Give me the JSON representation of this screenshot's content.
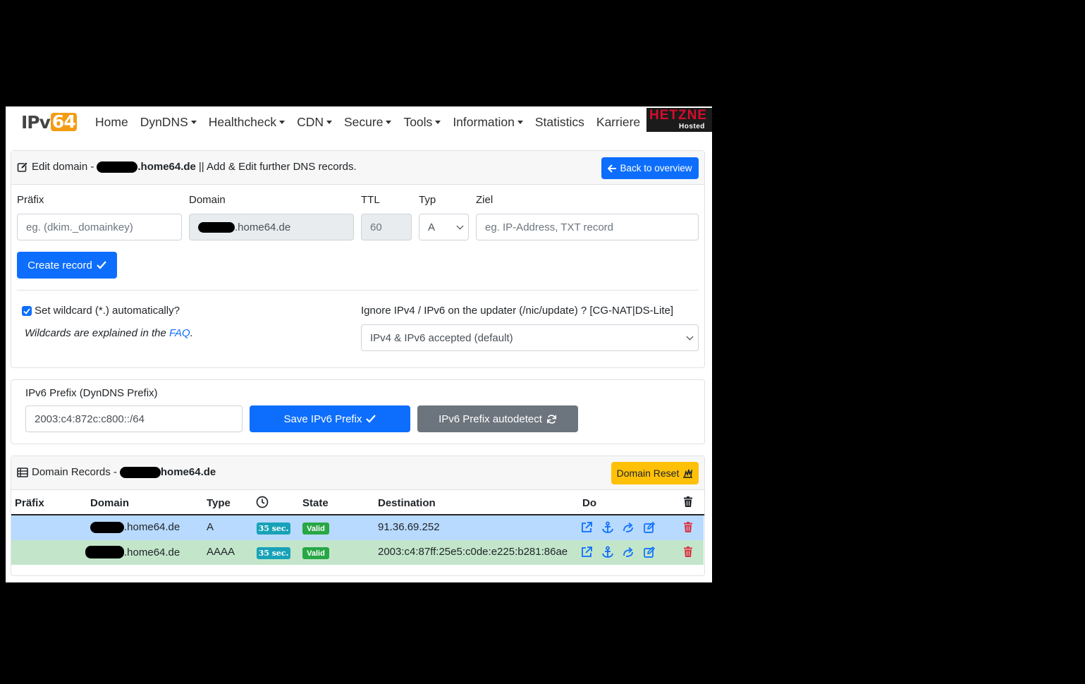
{
  "nav": {
    "logo_text": "IPv",
    "logo_num": "64",
    "items": [
      {
        "label": "Home",
        "dropdown": false
      },
      {
        "label": "DynDNS",
        "dropdown": true
      },
      {
        "label": "Healthcheck",
        "dropdown": true
      },
      {
        "label": "CDN",
        "dropdown": true
      },
      {
        "label": "Secure",
        "dropdown": true
      },
      {
        "label": "Tools",
        "dropdown": true
      },
      {
        "label": "Information",
        "dropdown": true
      },
      {
        "label": "Statistics",
        "dropdown": false
      },
      {
        "label": "Karriere",
        "dropdown": false
      }
    ],
    "sponsor": {
      "name": "HETZNE",
      "sub": "Hosted"
    }
  },
  "edit": {
    "title_prefix": "Edit domain -",
    "domain_suffix": ".home64.de",
    "title_suffix": "|| Add & Edit further DNS records.",
    "back_button": "Back to overview",
    "labels": {
      "prefix": "Präfix",
      "domain": "Domain",
      "ttl": "TTL",
      "type": "Typ",
      "target": "Ziel"
    },
    "prefix_placeholder": "eg. (dkim._domainkey)",
    "domain_value": ".home64.de",
    "ttl_value": "60",
    "type_value": "A",
    "target_placeholder": "eg. IP-Address, TXT record",
    "create_button": "Create record",
    "wildcard_label": "Set wildcard (*.) automatically?",
    "wildcard_checked": true,
    "wildcard_note_prefix": "Wildcards are explained in the",
    "wildcard_link": "FAQ",
    "wildcard_note_suffix": ".",
    "ignore_label": "Ignore IPv4 / IPv6 on the updater (/nic/update) ? [CG-NAT|DS-Lite]",
    "ignore_value": "IPv4 & IPv6 accepted (default)"
  },
  "ipv6": {
    "label": "IPv6 Prefix (DynDNS Prefix)",
    "value": "2003:c4:872c:c800::/64",
    "save_button": "Save IPv6 Prefix",
    "autodetect_button": "IPv6 Prefix autodetect"
  },
  "records": {
    "title_prefix": "Domain Records -",
    "domain_suffix": "home64.de",
    "reset_button": "Domain Reset",
    "headers": {
      "prefix": "Präfix",
      "domain": "Domain",
      "type": "Type",
      "state": "State",
      "destination": "Destination",
      "do": "Do"
    },
    "rows": [
      {
        "prefix": "",
        "domain": ".home64.de",
        "type": "A",
        "ttl": "35 sec.",
        "state": "Valid",
        "destination": "91.36.69.252",
        "color": "#b8daff"
      },
      {
        "prefix": "",
        "domain": ".home64.de",
        "type": "AAAA",
        "ttl": "35 sec.",
        "state": "Valid",
        "destination": "2003:c4:87ff:25e5:c0de:e225:b281:86ae",
        "color": "#c3e6cb"
      }
    ]
  },
  "colors": {
    "primary": "#0d6efd",
    "secondary": "#6c757d",
    "warning": "#ffc107",
    "danger": "#dc3545",
    "link": "#0d6efd"
  }
}
